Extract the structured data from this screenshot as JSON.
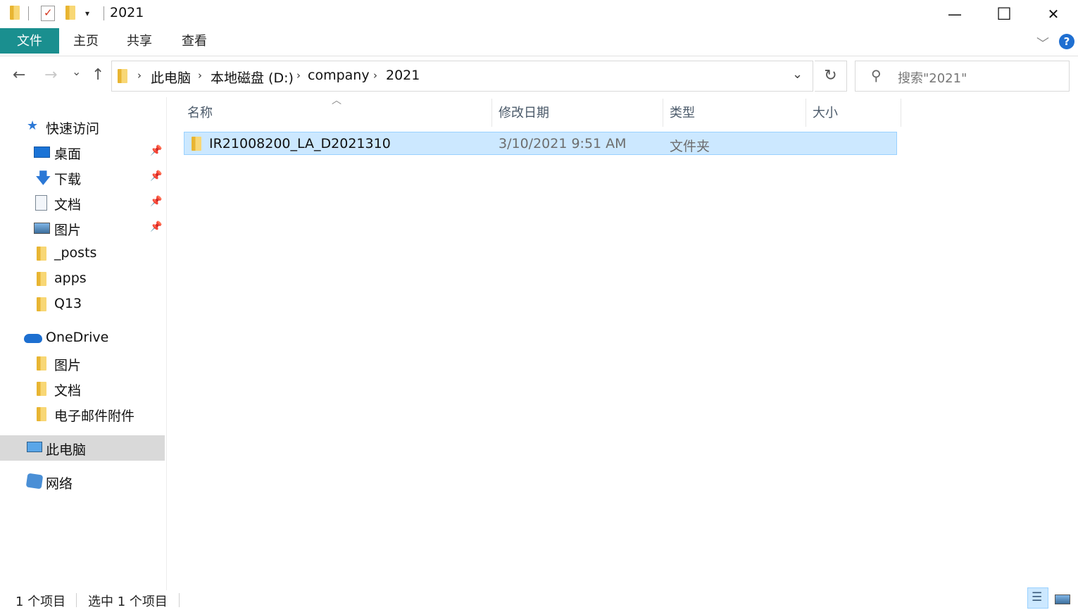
{
  "window": {
    "title": "2021",
    "minimize": "—",
    "maximize": "☐",
    "close": "✕"
  },
  "ribbon": {
    "tabs": [
      "文件",
      "主页",
      "共享",
      "查看"
    ]
  },
  "nav": {
    "back": "←",
    "forward": "→",
    "recent": "⌄",
    "up": "↑",
    "breadcrumb": [
      "此电脑",
      "本地磁盘 (D:)",
      "company",
      "2021"
    ],
    "dropdown": "⌄",
    "refresh": "↻",
    "search_placeholder": "搜索\"2021\""
  },
  "sidebar": {
    "quick_access": "快速访问",
    "quick_items": [
      "桌面",
      "下载",
      "文档",
      "图片",
      "_posts",
      "apps",
      "Q13"
    ],
    "onedrive": "OneDrive",
    "onedrive_items": [
      "图片",
      "文档",
      "电子邮件附件"
    ],
    "this_pc": "此电脑",
    "network": "网络"
  },
  "list": {
    "columns": [
      "名称",
      "修改日期",
      "类型",
      "大小"
    ],
    "rows": [
      {
        "name": "IR21008200_LA_D2021310",
        "modified": "3/10/2021 9:51 AM",
        "type": "文件夹",
        "size": ""
      }
    ]
  },
  "status": {
    "count": "1 个项目",
    "selected": "选中 1 个项目"
  },
  "colors": {
    "file_tab": "#1a8f8f",
    "selection": "#cce8ff",
    "sidebar_selected": "#d9d9d9",
    "help": "#1f6fd1"
  },
  "icons": [
    "folder-icon",
    "properties-icon",
    "quick-access-dropdown-icon",
    "star-icon",
    "pin-icon",
    "cloud-icon",
    "computer-icon",
    "network-icon",
    "search-icon",
    "help-icon",
    "details-view-icon",
    "large-icons-view-icon"
  ]
}
